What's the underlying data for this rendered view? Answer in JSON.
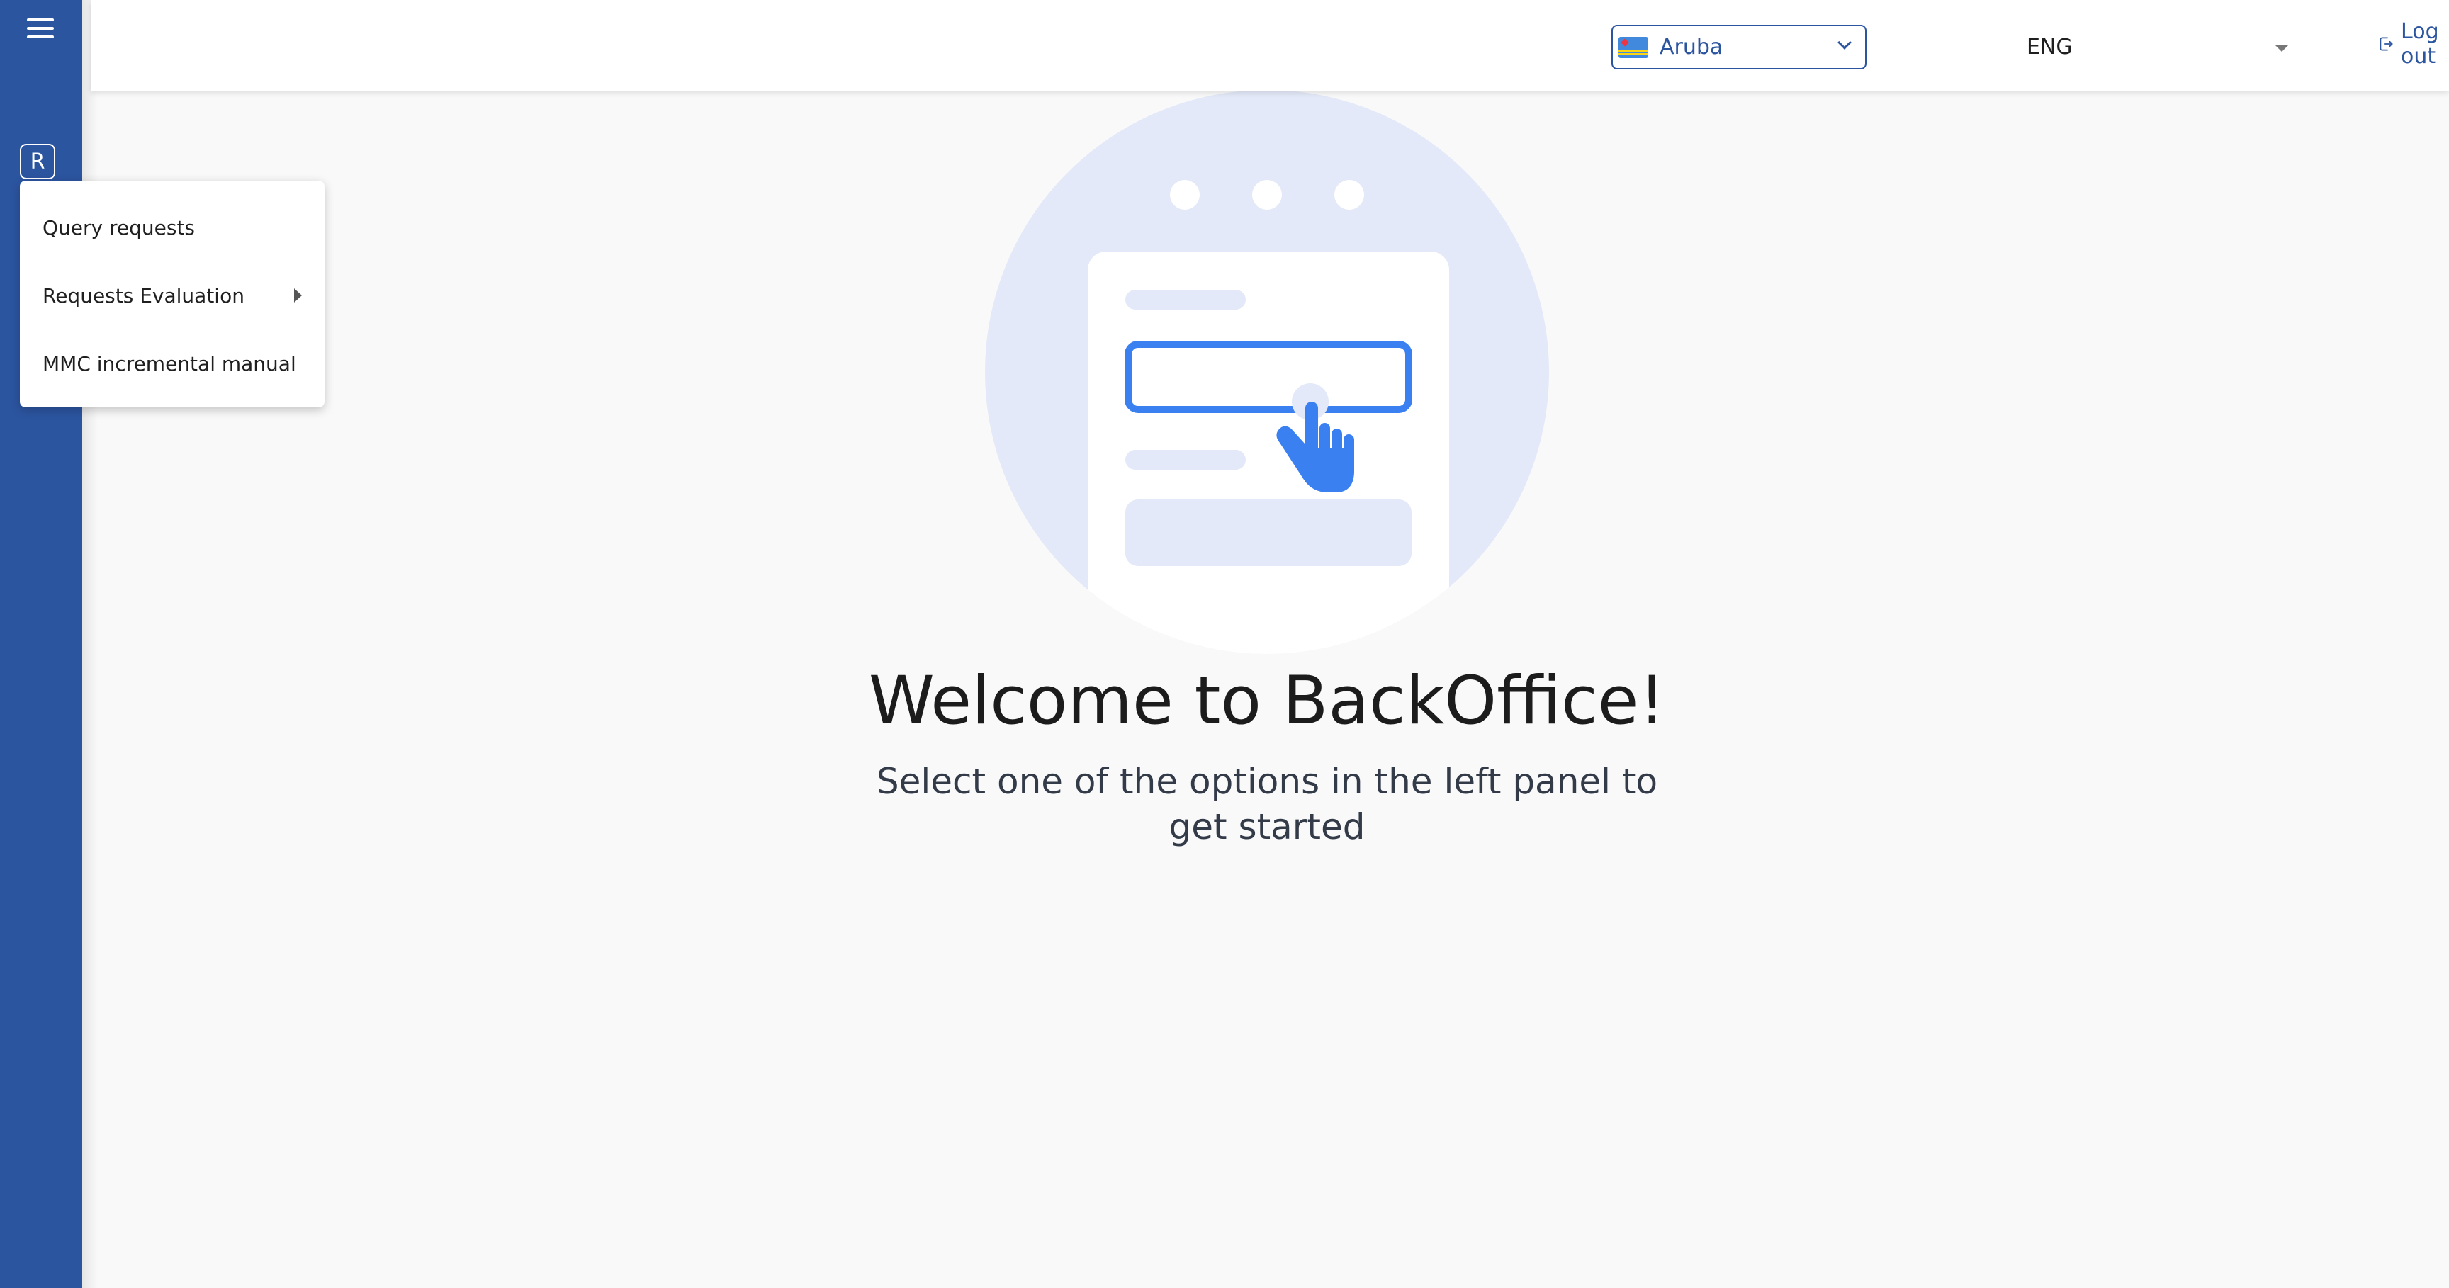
{
  "sidebar": {
    "role_badge": "R",
    "menu_items": [
      {
        "label": "Query requests",
        "has_submenu": false
      },
      {
        "label": "Requests Evaluation",
        "has_submenu": true
      },
      {
        "label": "MMC incremental manual",
        "has_submenu": false
      }
    ]
  },
  "header": {
    "country": {
      "value": "Aruba",
      "flag": "aruba-flag-icon"
    },
    "language": {
      "value": "ENG"
    },
    "logout_label": "Log out"
  },
  "main": {
    "title": "Welcome to BackOffice!",
    "subtitle": "Select one of the options in the left panel to get started"
  },
  "colors": {
    "sidebar": "#2c55a0",
    "accent": "#2c55a0",
    "illustration_circle": "#e3e9f8",
    "illustration_blue": "#3b80f0",
    "background": "#f9f9f9"
  }
}
